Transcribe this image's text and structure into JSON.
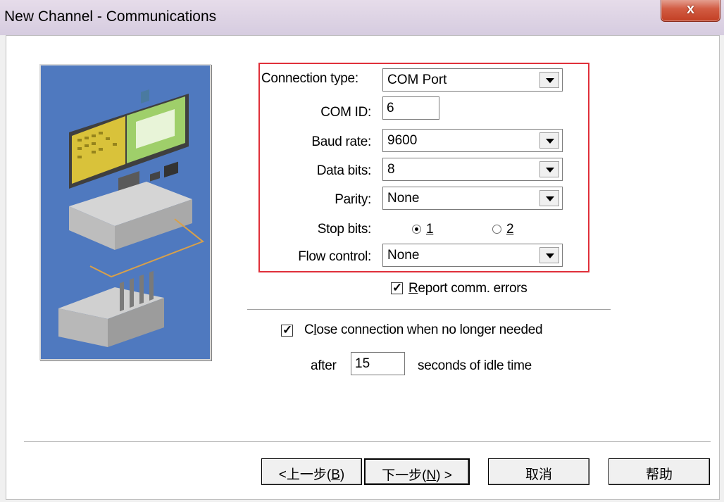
{
  "window": {
    "title": "New Channel - Communications",
    "close_glyph": "x"
  },
  "form": {
    "connection_type": {
      "label": "Connection type:",
      "value": "COM Port"
    },
    "com_id": {
      "label": "COM ID:",
      "value": "6"
    },
    "baud_rate": {
      "label": "Baud rate:",
      "value": "9600"
    },
    "data_bits": {
      "label": "Data bits:",
      "value": "8"
    },
    "parity": {
      "label": "Parity:",
      "value": "None"
    },
    "stop_bits": {
      "label": "Stop bits:",
      "option_1": "1",
      "option_2": "2",
      "selected": "1"
    },
    "flow_control": {
      "label": "Flow control:",
      "value": "None"
    },
    "report_errors": {
      "accel": "R",
      "label_rest": "eport comm. errors",
      "checked": true
    },
    "close_connection": {
      "label_pre": "C",
      "accel": "l",
      "label_rest": "ose connection when no longer needed",
      "checked": true
    },
    "idle": {
      "prefix": "after",
      "value": "15",
      "suffix": "seconds of idle time"
    }
  },
  "buttons": {
    "back": {
      "pre": "<上一步(",
      "accel": "B",
      "post": ")"
    },
    "next": {
      "pre": "下一步(",
      "accel": "N",
      "post": ") >"
    },
    "cancel": "取消",
    "help": "帮助"
  },
  "colors": {
    "highlight_border": "#e0303a",
    "picture_bg": "#4f79bf",
    "close_button": "#c94a33"
  },
  "icons": {
    "illustration": "computer-connected-to-plc-illustration",
    "checkmark": "✓"
  }
}
